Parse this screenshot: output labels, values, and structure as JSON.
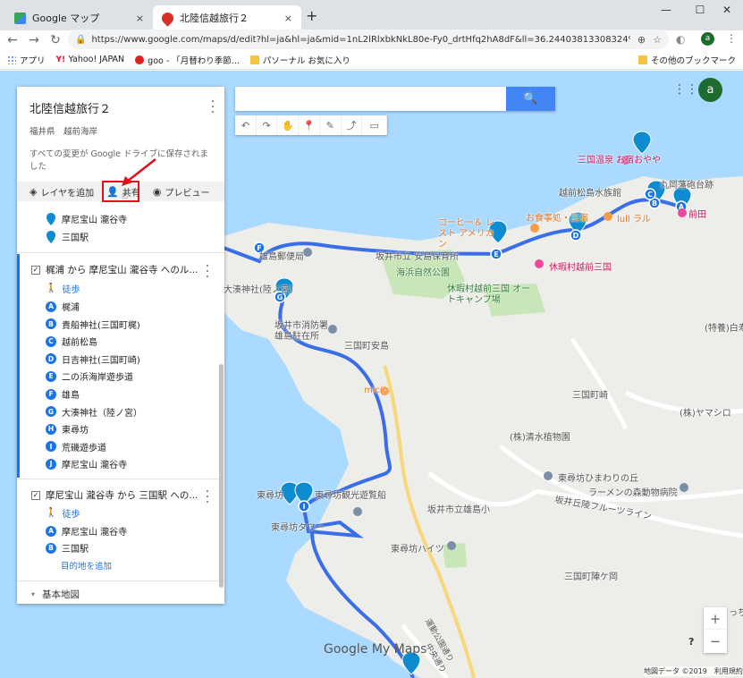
{
  "browser": {
    "tabs": [
      {
        "title": "Google マップ",
        "close": "×"
      },
      {
        "title": "北陸信越旅行２",
        "close": "×"
      }
    ],
    "new_tab": "+",
    "window_buttons": [
      "—",
      "☐",
      "✕"
    ],
    "url": "https://www.google.com/maps/d/edit?hl=ja&hl=ja&mid=1nL2lRlxbkNkL80e-Fy0_drtHfq2hA8dF&ll=36.24403813308324%2C136.13071138...",
    "account_initial": "a",
    "bookmarks": [
      "アプリ",
      "Yahoo! JAPAN",
      "goo - 「月替わり季節...",
      "パソーナル お気に入り"
    ],
    "other_bookmarks": "その他のブックマーク"
  },
  "panel": {
    "title": "北陸信越旅行２",
    "description": "福井県　越前海岸",
    "save_note": "すべての変更が Google ドライブに保存されました",
    "actions": {
      "add_layer": "レイヤを追加",
      "share": "共有",
      "preview": "プレビュー"
    },
    "top_items": [
      "摩尼宝山 瀧谷寺",
      "三国駅"
    ],
    "layer1": {
      "title": "梶浦 から 摩尼宝山 瀧谷寺 へのル...",
      "mode": "徒歩",
      "stops": [
        {
          "letter": "A",
          "name": "梶浦"
        },
        {
          "letter": "B",
          "name": "貴船神社(三国町梶)"
        },
        {
          "letter": "C",
          "name": "越前松島"
        },
        {
          "letter": "D",
          "name": "日吉神社(三国町崎)"
        },
        {
          "letter": "E",
          "name": "二の浜海岸遊歩道"
        },
        {
          "letter": "F",
          "name": "雄島"
        },
        {
          "letter": "G",
          "name": "大湊神社（陸ノ宮）"
        },
        {
          "letter": "H",
          "name": "東尋坊"
        },
        {
          "letter": "I",
          "name": "荒磯遊歩道"
        },
        {
          "letter": "J",
          "name": "摩尼宝山 瀧谷寺"
        }
      ]
    },
    "layer2": {
      "title": "摩尼宝山 瀧谷寺 から 三国駅 への...",
      "mode": "徒歩",
      "stops": [
        {
          "letter": "A",
          "name": "摩尼宝山 瀧谷寺"
        },
        {
          "letter": "B",
          "name": "三国駅"
        }
      ],
      "add_destination": "目的地を追加"
    },
    "basemap": "基本地図"
  },
  "map": {
    "search_placeholder": "",
    "labels": [
      "三国温泉 お宿おやや",
      "丸岡藩砲台跡",
      "越前松島水族館",
      "前田",
      "お食事処・民宿",
      "lull ラル",
      "コーヒー＆ レスト アメリカン",
      "坂井市立 安島保育所",
      "海浜自然公園",
      "休暇村越前三国",
      "休暇村越前三国 オートキャンプ場",
      "雄島郵便局",
      "大湊神社(陸ノ宮)",
      "坂井市消防署 雄島駐在所",
      "三国町安島",
      "micic",
      "三国町崎",
      "(特養)白寿",
      "(株)清水植物園",
      "(株)ヤマシロ",
      "東尋坊ひまわりの丘",
      "ラーメンの森動物病院",
      "坂井丘陵フルーツライン",
      "東尋坊",
      "東尋坊観光遊覧船",
      "坂井市立雄島小",
      "東尋坊タワー",
      "東尋坊ハイツ",
      "三国町陣ケ岡",
      "運動公園通り",
      "中央通り",
      "さっち"
    ],
    "logo": "Google My Maps",
    "footer": "地図データ ©2019　利用規約",
    "zoom_in": "+",
    "zoom_out": "−",
    "help": "?",
    "route_color": "#3a6ee8",
    "water_color": "#aadaff"
  }
}
